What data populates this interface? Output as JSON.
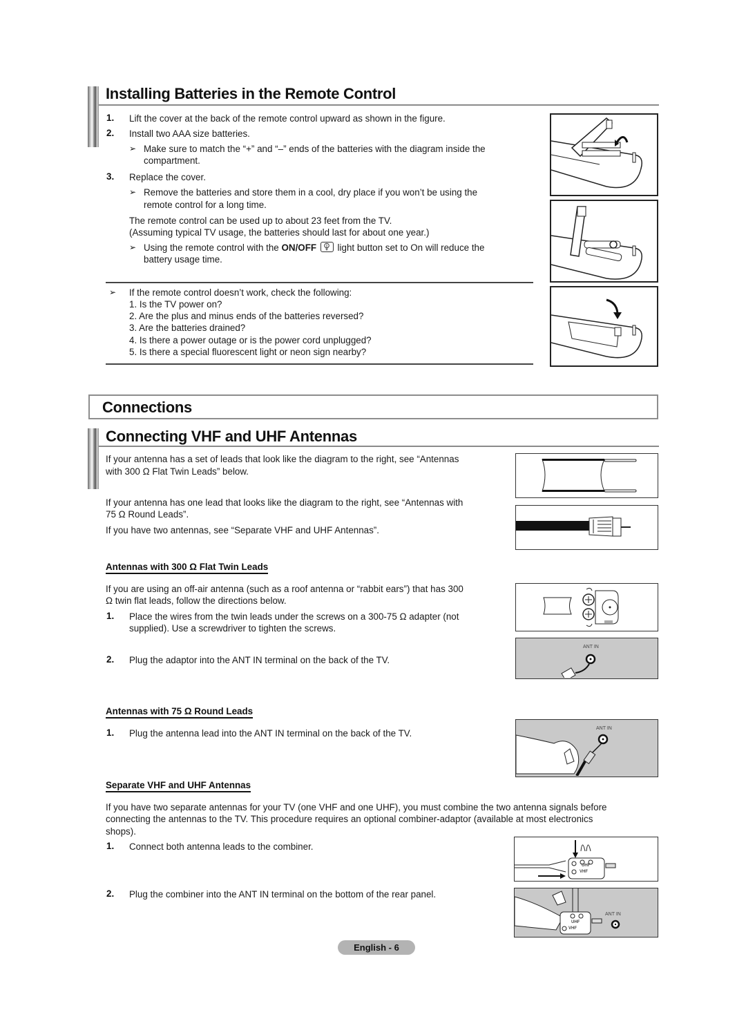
{
  "batteries": {
    "title": "Installing Batteries in the Remote Control",
    "steps": [
      {
        "num": "1.",
        "text": "Lift the cover at the back of the remote control upward as shown in the figure."
      },
      {
        "num": "2.",
        "text": "Install two AAA size batteries."
      },
      {
        "num": "3.",
        "text": "Replace the cover."
      }
    ],
    "note_match_line1": "Make sure to match the “+” and “–” ends of the batteries with the diagram inside the",
    "note_match_line2": "compartment.",
    "note_remove_line1": "Remove the batteries and store them in a cool, dry place if you won’t be using the",
    "note_remove_line2": "remote control for a long time.",
    "range_line1": "The remote control can be used up to about 23 feet from the TV.",
    "range_line2": "(Assuming typical TV usage, the batteries should last for about one year.)",
    "note_light_pre": "Using the remote control with the",
    "note_light_bold": "ON/OFF",
    "note_light_post": "light button set to On will reduce the",
    "note_light_line2": "battery usage time.",
    "light_icon": "light-bulb-icon",
    "troubleshoot_intro": "If the remote control doesn’t work, check the following:",
    "troubleshoot": [
      "1. Is the TV power on?",
      "2. Are the plus and minus ends of the batteries reversed?",
      "3. Are the batteries drained?",
      "4. Is there a power outage or is the power cord unplugged?",
      "5. Is there a special fluorescent light or neon sign nearby?"
    ],
    "note_arrow": "➢"
  },
  "connections": {
    "title": "Connections"
  },
  "antennas": {
    "title": "Connecting VHF and UHF Antennas",
    "intro_300_line1": "If your antenna has a set of leads that look like the diagram to the right, see “Antennas",
    "intro_300_line2": "with 300 Ω Flat Twin Leads” below.",
    "intro_75_line1": "If your antenna has one lead that looks like the diagram to the right, see “Antennas with",
    "intro_75_line2": "75 Ω Round Leads”.",
    "intro_two": "If you have two antennas, see “Separate VHF and UHF Antennas”.",
    "flat": {
      "heading": "Antennas with 300 Ω Flat Twin Leads",
      "intro_line1": "If you are using an off-air antenna (such as a roof antenna or “rabbit ears”) that has 300",
      "intro_line2": "Ω twin flat leads, follow the directions below.",
      "step1_num": "1.",
      "step1_line1": "Place the wires from the twin leads under the screws on a 300-75 Ω adapter (not",
      "step1_line2": "supplied). Use a screwdriver to tighten the screws.",
      "step2_num": "2.",
      "step2": "Plug the adaptor into the ANT IN terminal on the back of the TV.",
      "fig_label": "ANT IN"
    },
    "round": {
      "heading": "Antennas with 75 Ω Round Leads",
      "step1_num": "1.",
      "step1": "Plug the antenna lead into the ANT IN terminal on the back of the TV.",
      "fig_label": "ANT IN"
    },
    "separate": {
      "heading": "Separate VHF and UHF Antennas",
      "intro_line1": "If you have two separate antennas for your TV (one VHF and one UHF), you must combine the two antenna signals before",
      "intro_line2": "connecting the antennas to the TV. This procedure requires an optional combiner-adaptor (available at most electronics",
      "intro_line3": "shops).",
      "step1_num": "1.",
      "step1": "Connect both antenna leads to the combiner.",
      "step2_num": "2.",
      "step2": "Plug the combiner into the ANT IN terminal on the bottom of the rear panel.",
      "uhf_label": "UHF",
      "vhf_label": "VHF",
      "fig_label": "ANT IN"
    }
  },
  "footer": {
    "page_label": "English - 6"
  }
}
